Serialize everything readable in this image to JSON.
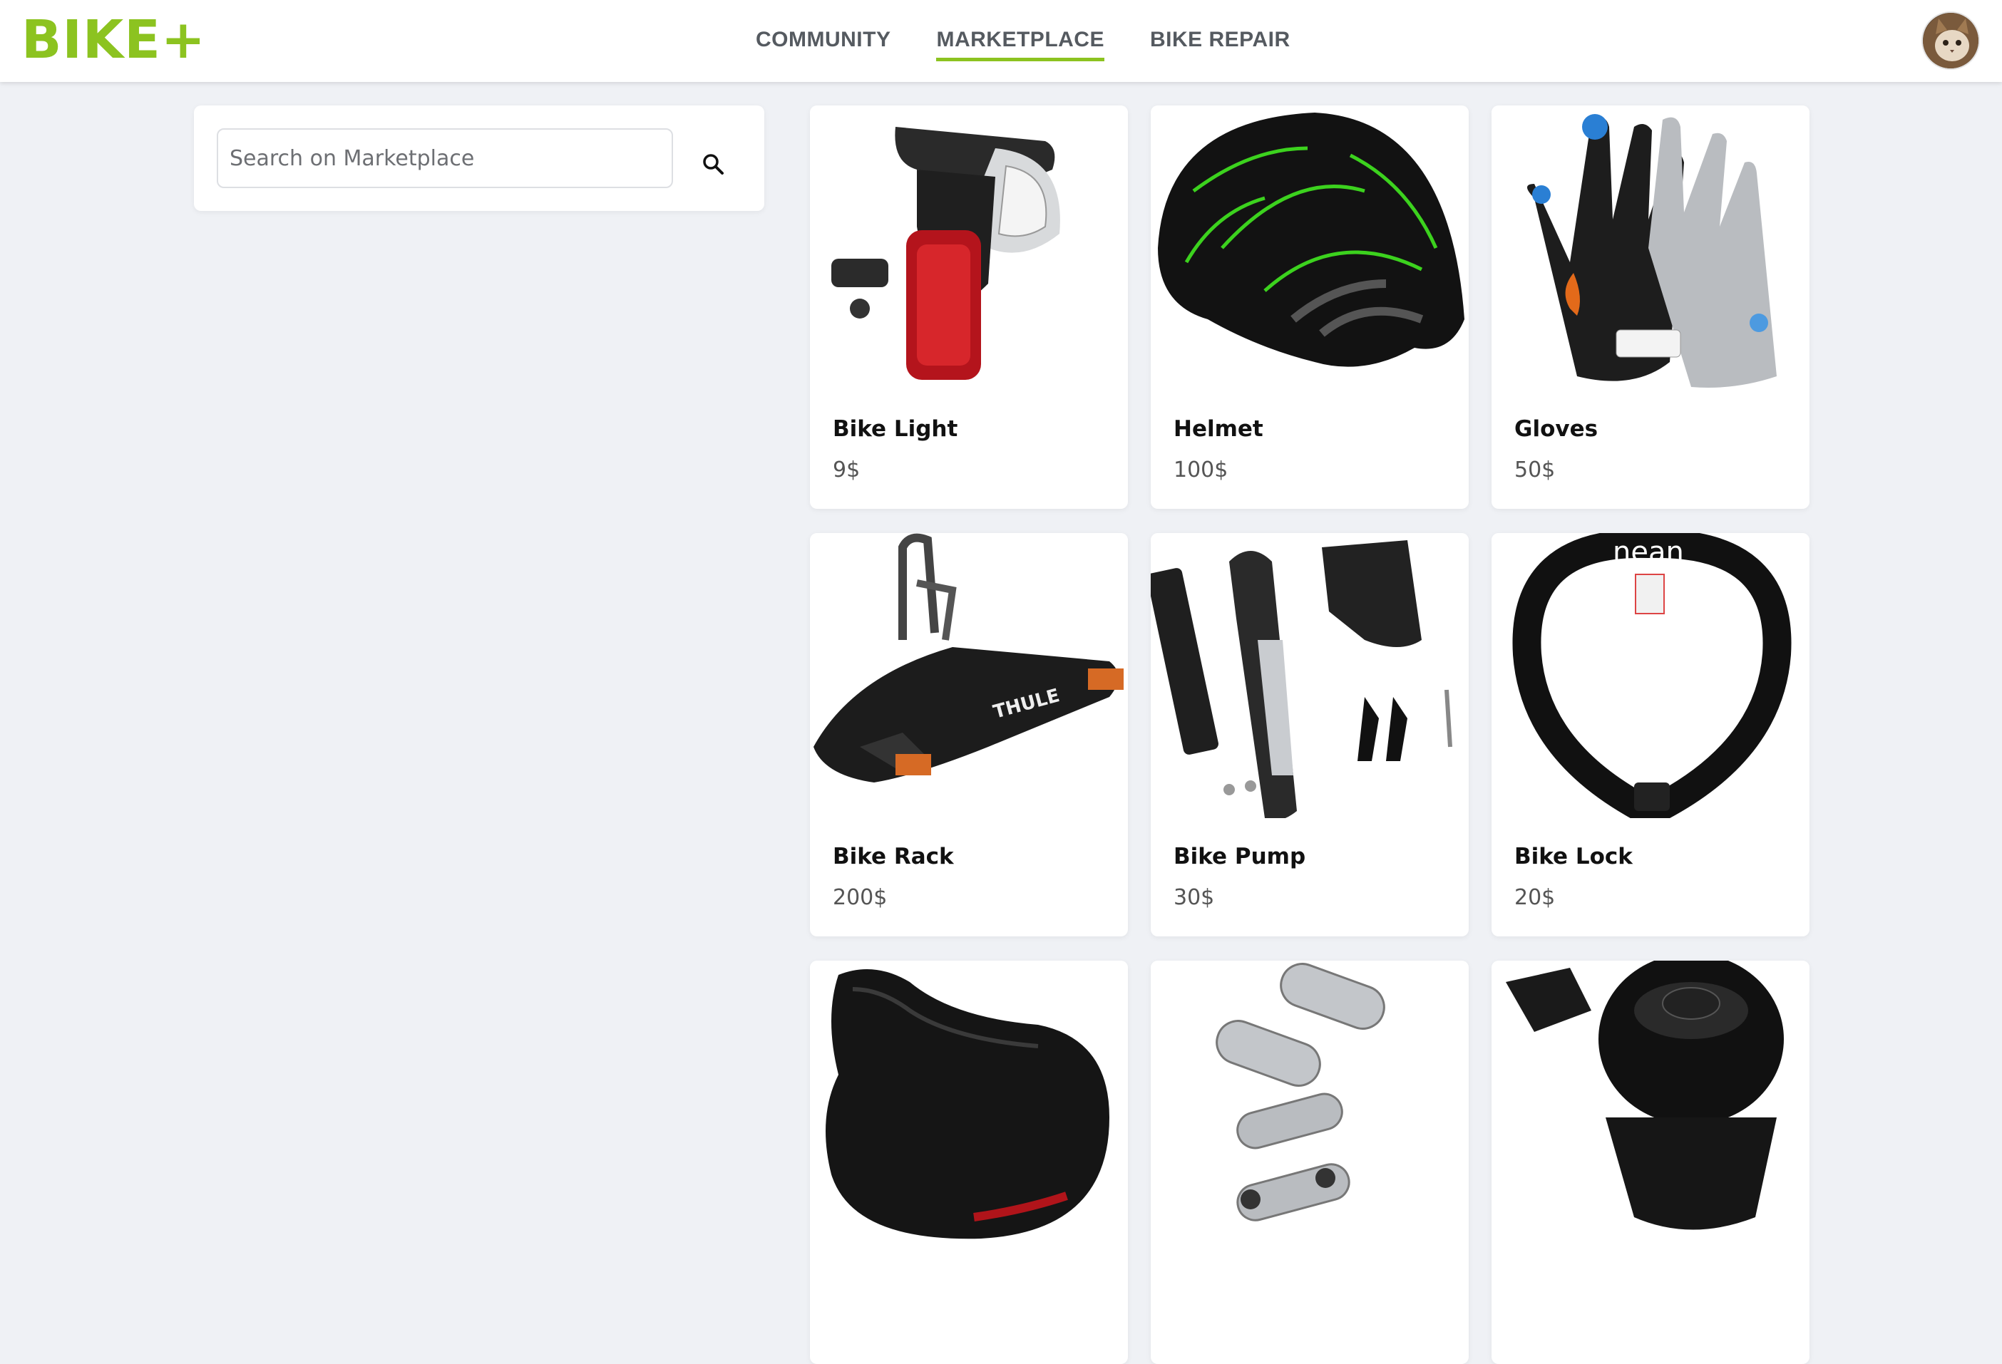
{
  "brand": {
    "logo_text": "BIKE+",
    "accent_color": "#8cc320"
  },
  "nav": {
    "items": [
      {
        "label": "COMMUNITY",
        "active": false
      },
      {
        "label": "MARKETPLACE",
        "active": true
      },
      {
        "label": "BIKE REPAIR",
        "active": false
      }
    ]
  },
  "user": {
    "avatar_icon": "user-avatar-cat-photo"
  },
  "search": {
    "placeholder": "Search on Marketplace",
    "value": "",
    "button_icon": "search-icon"
  },
  "products": [
    {
      "name": "Bike Light",
      "price": "9$",
      "image": "bike-light-photo"
    },
    {
      "name": "Helmet",
      "price": "100$",
      "image": "helmet-photo"
    },
    {
      "name": "Gloves",
      "price": "50$",
      "image": "gloves-photo"
    },
    {
      "name": "Bike Rack",
      "price": "200$",
      "image": "bike-rack-photo"
    },
    {
      "name": "Bike Pump",
      "price": "30$",
      "image": "bike-pump-photo"
    },
    {
      "name": "Bike Lock",
      "price": "20$",
      "image": "bike-lock-photo"
    },
    {
      "name": "",
      "price": "",
      "image": "bike-saddle-photo"
    },
    {
      "name": "",
      "price": "",
      "image": "chain-links-photo"
    },
    {
      "name": "",
      "price": "",
      "image": "bike-bell-photo"
    }
  ]
}
